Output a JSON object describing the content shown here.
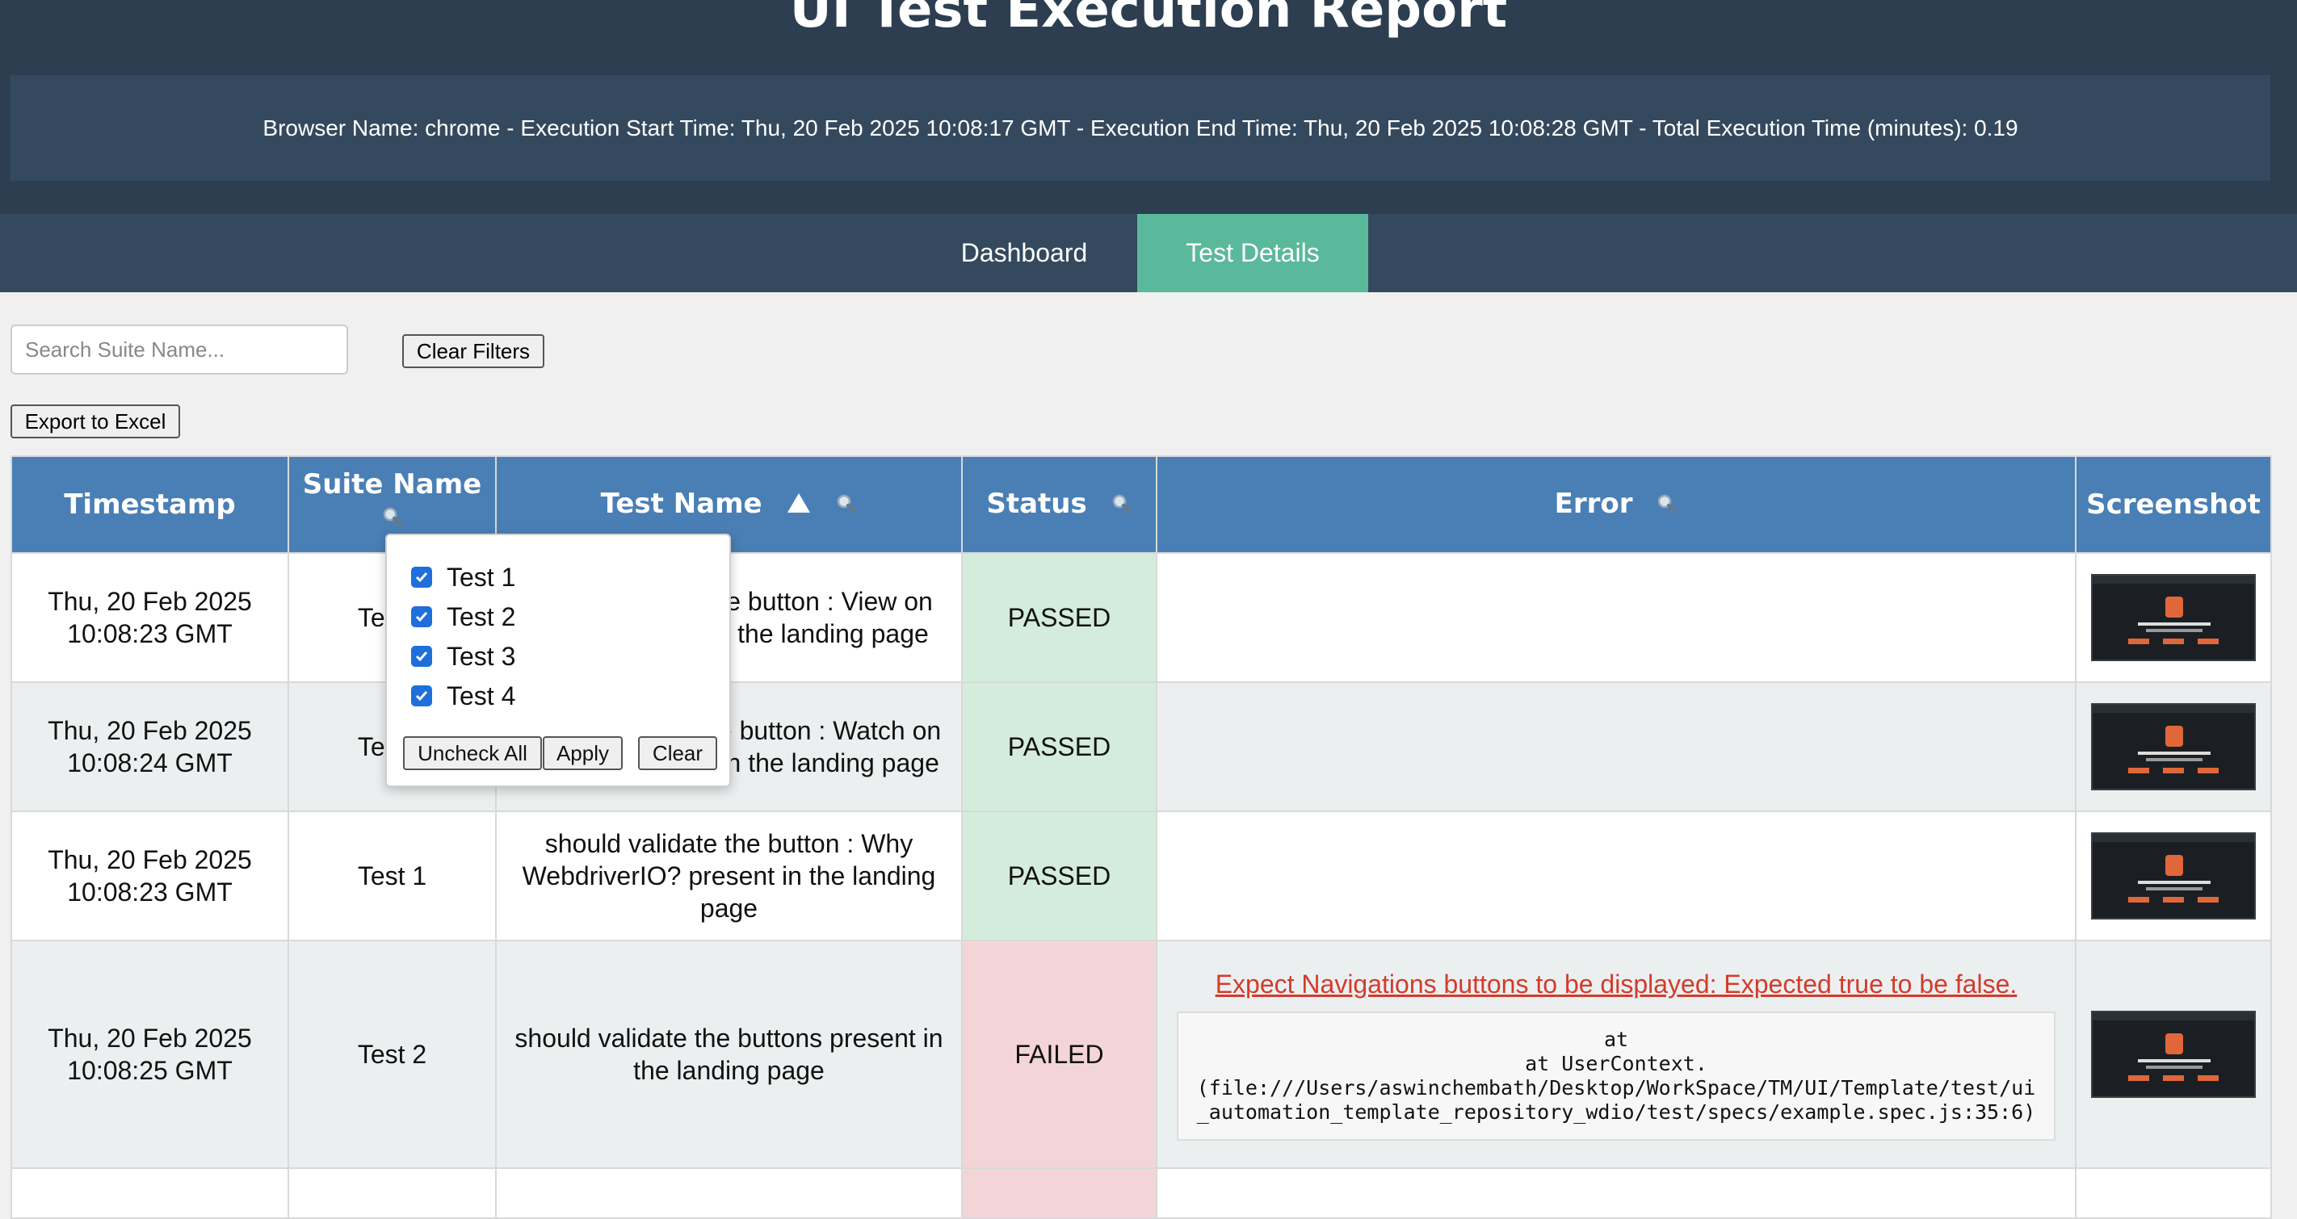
{
  "header": {
    "title": "UI Test Execution Report",
    "info": "Browser Name: chrome - Execution Start Time: Thu, 20 Feb 2025 10:08:17 GMT - Execution End Time: Thu, 20 Feb 2025 10:08:28 GMT - Total Execution Time (minutes): 0.19"
  },
  "tabs": [
    "Dashboard",
    "Test Details"
  ],
  "active_tab": "Test Details",
  "filters": {
    "search_placeholder": "Search Suite Name...",
    "clear_filters": "Clear Filters",
    "export": "Export to Excel"
  },
  "table": {
    "headers": {
      "timestamp": "Timestamp",
      "suite": "Suite Name",
      "test": "Test Name",
      "status": "Status",
      "error": "Error",
      "screenshot": "Screenshot"
    },
    "rows": [
      {
        "ts_date": "Thu, 20 Feb 2025",
        "ts_time": "10:08:23 GMT",
        "suite": "Test 1",
        "test": "should validate the button : View on GitHub present in the landing page",
        "status": "PASSED"
      },
      {
        "ts_date": "Thu, 20 Feb 2025",
        "ts_time": "10:08:24 GMT",
        "suite": "Test 1",
        "test": "should validate the button : Watch on YouTube present in the landing page",
        "status": "PASSED"
      },
      {
        "ts_date": "Thu, 20 Feb 2025",
        "ts_time": "10:08:23 GMT",
        "suite": "Test 1",
        "test": "should validate the button : Why WebdriverIO? present in the landing page",
        "status": "PASSED"
      },
      {
        "ts_date": "Thu, 20 Feb 2025",
        "ts_time": "10:08:25 GMT",
        "suite": "Test 2",
        "test": "should validate the buttons present in the landing page",
        "status": "FAILED",
        "error_message": "Expect Navigations buttons to be displayed: Expected true to be false.",
        "stack_line1": "at",
        "stack_line2": "at UserContext.",
        "stack_line3": "(file:///Users/aswinchembath/Desktop/WorkSpace/TM/UI/Template/test/ui_automation_template_repository_wdio/test/specs/example.spec.js:35:6)"
      }
    ]
  },
  "suite_filter_popup": {
    "options": [
      {
        "label": "Test 1",
        "checked": true
      },
      {
        "label": "Test 2",
        "checked": true
      },
      {
        "label": "Test 3",
        "checked": true
      },
      {
        "label": "Test 4",
        "checked": true
      }
    ],
    "uncheck_all": "Uncheck All",
    "apply": "Apply",
    "clear": "Clear"
  },
  "colors": {
    "header_bg": "#2c3e50",
    "active_tab": "#5bb99b",
    "table_header": "#4a7fb5",
    "passed_bg": "#d4ecdc",
    "failed_bg": "#f3d5d8",
    "error_text": "#d33b2c"
  },
  "icons": {
    "sort": "sort-asc-triangle-icon",
    "filter": "magnifier-icon"
  }
}
